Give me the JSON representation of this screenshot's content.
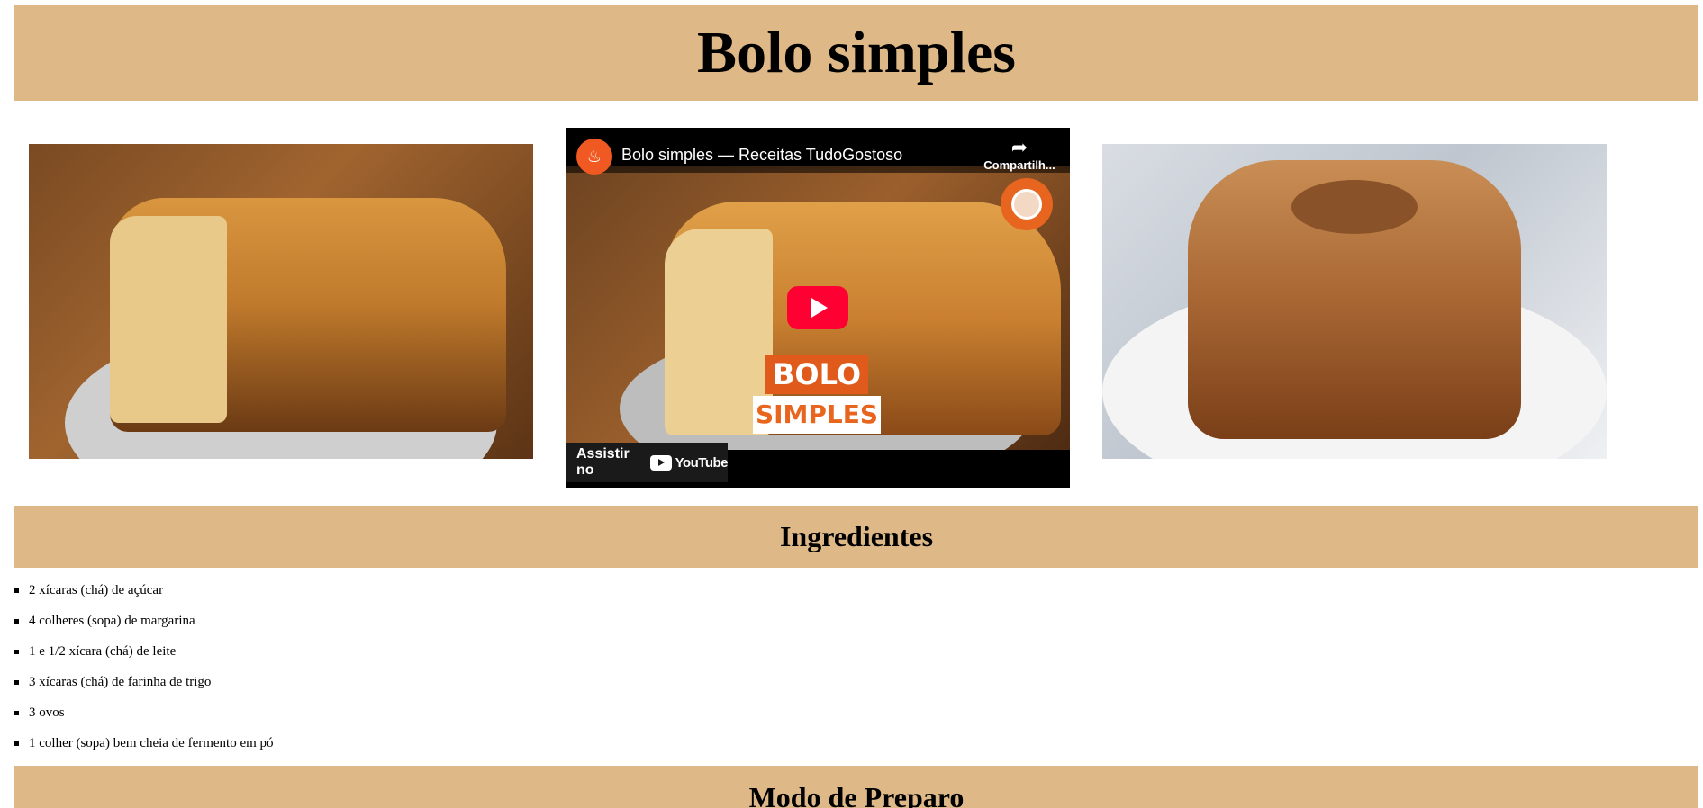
{
  "page": {
    "title": "Bolo simples"
  },
  "video": {
    "title": "Bolo simples — Receitas TudoGostoso",
    "share_label": "Compartilh...",
    "overlay_line1": "BOLO",
    "overlay_line2": "SIMPLES",
    "watch_label": "Assistir no",
    "youtube_word": "YouTube"
  },
  "sections": {
    "ingredients_title": "Ingredientes",
    "preparation_title": "Modo de Preparo"
  },
  "ingredients": [
    "2 xícaras (chá) de açúcar",
    "4 colheres (sopa) de margarina",
    "1 e 1/2 xícara (chá) de leite",
    "3 xícaras (chá) de farinha de trigo",
    "3 ovos",
    "1 colher (sopa) bem cheia de fermento em pó"
  ],
  "colors": {
    "banner": "#deb887",
    "youtube_red": "#ff0033",
    "brand_orange": "#e8651f"
  }
}
